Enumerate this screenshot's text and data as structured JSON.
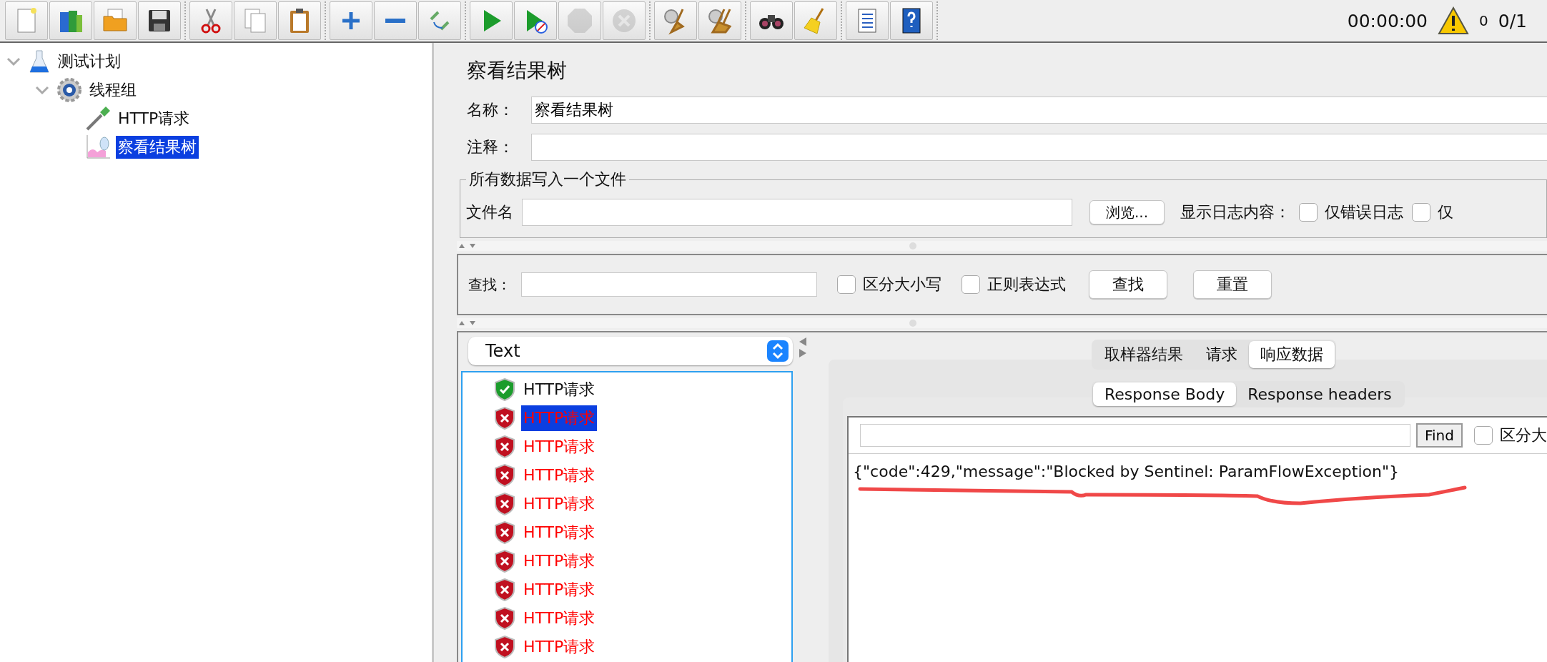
{
  "toolbar": {
    "groups": [
      [
        {
          "kind": "new",
          "disabled": false
        },
        {
          "kind": "templates",
          "disabled": false
        },
        {
          "kind": "open",
          "disabled": false
        },
        {
          "kind": "save",
          "disabled": false
        }
      ],
      [
        {
          "kind": "cut",
          "disabled": false
        },
        {
          "kind": "copy",
          "disabled": false
        },
        {
          "kind": "paste",
          "disabled": false
        }
      ],
      [
        {
          "kind": "expand",
          "disabled": false
        },
        {
          "kind": "collapse",
          "disabled": false
        },
        {
          "kind": "toggle",
          "disabled": false
        }
      ],
      [
        {
          "kind": "start",
          "disabled": false
        },
        {
          "kind": "start_no_timers",
          "disabled": false
        },
        {
          "kind": "stop",
          "disabled": true
        },
        {
          "kind": "shutdown",
          "disabled": true
        }
      ],
      [
        {
          "kind": "clear",
          "disabled": false
        },
        {
          "kind": "clear_all",
          "disabled": false
        }
      ],
      [
        {
          "kind": "search",
          "disabled": false
        },
        {
          "kind": "reset_search",
          "disabled": false
        }
      ],
      [
        {
          "kind": "functions",
          "disabled": false
        },
        {
          "kind": "help",
          "disabled": false
        }
      ]
    ],
    "timer": "00:00:00",
    "warnings": "0",
    "threads": "0/1"
  },
  "tree": [
    {
      "label": "测试计划",
      "kind": "plan",
      "expanded": true,
      "selected": false,
      "children": [
        {
          "label": "线程组",
          "kind": "thread_group",
          "expanded": true,
          "selected": false,
          "children": [
            {
              "label": "HTTP请求",
              "kind": "sampler",
              "selected": false
            },
            {
              "label": "察看结果树",
              "kind": "listener",
              "selected": true
            }
          ]
        }
      ]
    }
  ],
  "panel": {
    "title": "察看结果树",
    "name": {
      "label": "名称：",
      "value": "察看结果树"
    },
    "comment": {
      "label": "注释："
    },
    "file_group": {
      "legend": "所有数据写入一个文件",
      "file_label": "文件名",
      "browse": "浏览...",
      "log_label": "显示日志内容：",
      "checkboxes": [
        {
          "label": "仅错误日志",
          "checked": false
        },
        {
          "label": "仅",
          "checked": false
        }
      ]
    },
    "search": {
      "label": "查找：",
      "checkboxes": [
        {
          "label": "区分大小写",
          "checked": false
        },
        {
          "label": "正则表达式",
          "checked": false
        }
      ],
      "buttons": [
        "查找",
        "重置"
      ]
    },
    "renderer": "Text",
    "results": [
      {
        "label": "HTTP请求",
        "passed": true,
        "selected": false
      },
      {
        "label": "HTTP请求",
        "passed": false,
        "selected": true
      },
      {
        "label": "HTTP请求",
        "passed": false,
        "selected": false
      },
      {
        "label": "HTTP请求",
        "passed": false,
        "selected": false
      },
      {
        "label": "HTTP请求",
        "passed": false,
        "selected": false
      },
      {
        "label": "HTTP请求",
        "passed": false,
        "selected": false
      },
      {
        "label": "HTTP请求",
        "passed": false,
        "selected": false
      },
      {
        "label": "HTTP请求",
        "passed": false,
        "selected": false
      },
      {
        "label": "HTTP请求",
        "passed": false,
        "selected": false
      },
      {
        "label": "HTTP请求",
        "passed": false,
        "selected": false
      }
    ],
    "tabs": [
      {
        "label": "取样器结果",
        "selected": false
      },
      {
        "label": "请求",
        "selected": false
      },
      {
        "label": "响应数据",
        "selected": true
      }
    ],
    "subtabs": [
      {
        "label": "Response Body",
        "selected": true
      },
      {
        "label": "Response headers",
        "selected": false
      }
    ],
    "find": {
      "button": "Find",
      "checkbox": {
        "label": "区分大",
        "checked": false
      }
    },
    "response": "{\"code\":429,\"message\":\"Blocked by Sentinel: ParamFlowException\"}"
  }
}
